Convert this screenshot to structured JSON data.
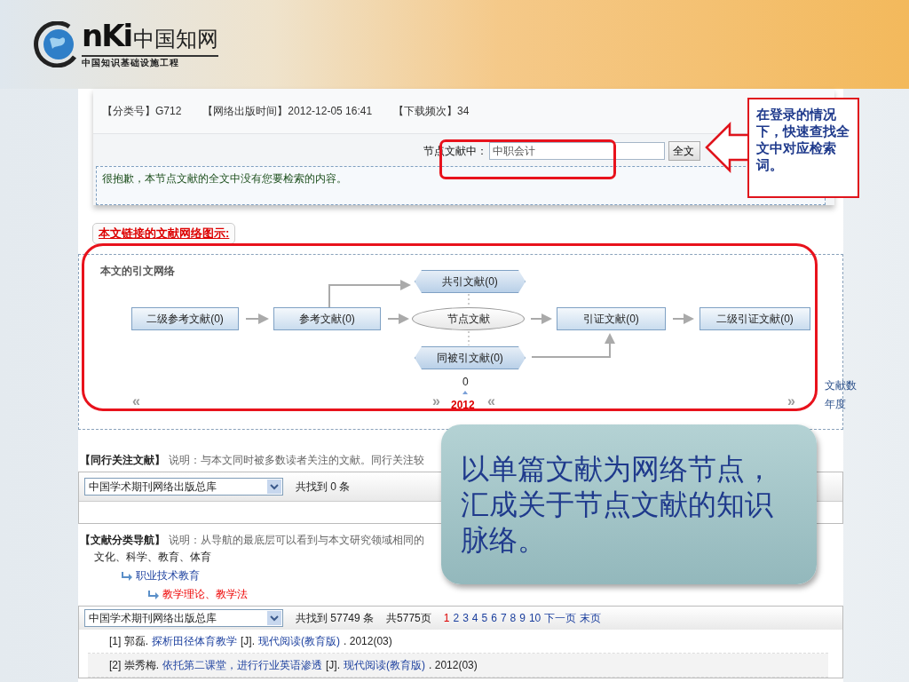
{
  "header": {
    "logo_mark": "nKi",
    "logo_name": "中国知网",
    "logo_tagline": "中国知识基础设施工程"
  },
  "meta": [
    "【分类号】G712",
    "【网络出版时间】2012-12-05 16:41",
    "【下载频次】34"
  ],
  "search": {
    "label": "节点文献中：",
    "value": "中职会计",
    "button": "全文"
  },
  "notice": "很抱歉，本节点文献的全文中没有您要检索的内容。",
  "search_callout": "在登录的情况下，快速查找全文中对应检索词。",
  "network": {
    "tab": "本文链接的文献网络图示:",
    "title": "本文的引文网络",
    "nodes": [
      {
        "label": "二级参考文献(0)",
        "kind": "box"
      },
      {
        "label": "参考文献(0)",
        "kind": "box"
      },
      {
        "label": "节点文献",
        "kind": "ellipse"
      },
      {
        "label": "引证文献(0)",
        "kind": "box"
      },
      {
        "label": "二级引证文献(0)",
        "kind": "box"
      },
      {
        "label": "共引文献(0)",
        "kind": "hex"
      },
      {
        "label": "同被引文献(0)",
        "kind": "hex"
      }
    ],
    "count": "0",
    "year": "2012",
    "left_scroll": "«",
    "year_prev": "»",
    "year_next": "«",
    "right_scroll": "»",
    "legend": [
      "文献数",
      "年度"
    ]
  },
  "peer": {
    "title": "【同行关注文献】",
    "note": "说明：与本文同时被多数读者关注的文献。同行关注较",
    "database": "中国学术期刊网络出版总库",
    "found": "共找到 0 条"
  },
  "classification": {
    "title": "【文献分类导航】",
    "note": "说明：从导航的最底层可以看到与本文研究领域相同的",
    "tree": [
      {
        "label": "文化、科学、教育、体育",
        "selected": false,
        "children": [
          {
            "label": "职业技术教育",
            "selected": false,
            "children": [
              {
                "label": "教学理论、教学法",
                "selected": true
              }
            ]
          }
        ]
      }
    ]
  },
  "results": {
    "database": "中国学术期刊网络出版总库",
    "found": "共找到 57749 条",
    "pages_total": "共5775页",
    "pages": [
      {
        "label": "1",
        "selected": true
      },
      {
        "label": "2",
        "selected": false
      },
      {
        "label": "3",
        "selected": false
      },
      {
        "label": "4",
        "selected": false
      },
      {
        "label": "5",
        "selected": false
      },
      {
        "label": "6",
        "selected": false
      },
      {
        "label": "7",
        "selected": false
      },
      {
        "label": "8",
        "selected": false
      },
      {
        "label": "9",
        "selected": false
      },
      {
        "label": "10",
        "selected": false
      }
    ],
    "next": "下一页",
    "last": "末页",
    "rows": [
      {
        "index": "[1]",
        "author": "郭磊.",
        "title": "探析田径体育教学",
        "type": "[J].",
        "source": "现代阅读(教育版)",
        "year": ". 2012(03)"
      },
      {
        "index": "[2]",
        "author": "崇秀梅.",
        "title": "依托第二课堂，进行行业英语渗透",
        "type": "[J].",
        "source": "现代阅读(教育版)",
        "year": ". 2012(03)"
      }
    ]
  },
  "summary_callout": "以单篇文献为网络节点，汇成关于节点文献的知识脉络。"
}
